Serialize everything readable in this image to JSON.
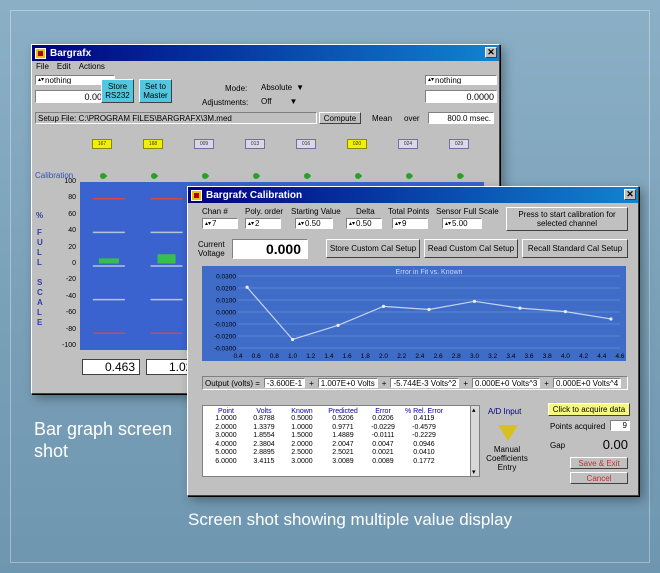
{
  "captions": {
    "bar_graph": "Bar graph screen shot",
    "multi_value": "Screen shot showing multiple value display"
  },
  "bargrafx": {
    "title": "Bargrafx",
    "menu": [
      "File",
      "Edit",
      "Actions"
    ],
    "left_select": "nothing",
    "left_value": "0.0000",
    "store_button": "Store RS232",
    "set_master_button": "Set to Master",
    "mode_label": "Mode:",
    "mode_value": "Absolute",
    "adjustments_label": "Adjustments:",
    "adjustments_value": "Off",
    "right_select": "nothing",
    "right_value": "0.0000",
    "setup_label": "Setup File:",
    "setup_path": "C:\\PROGRAM FILES\\BARGRAFX\\3M.med",
    "compute_label": "Compute",
    "mean_label": "Mean",
    "over_label": "over",
    "msec_value": "800.0 msec.",
    "channels": [
      "167",
      "168",
      "009",
      "013",
      "016",
      "020",
      "024",
      "029"
    ],
    "calibration_label": "Calibration",
    "y_ticks": [
      "100",
      "80",
      "60",
      "40",
      "20",
      "0",
      "-20",
      "-40",
      "-60",
      "-80",
      "-100"
    ],
    "side_letters_top": [
      "%"
    ],
    "side_letters": [
      "F",
      "U",
      "L",
      "L",
      "",
      "S",
      "C",
      "A",
      "L",
      "E"
    ],
    "readouts": [
      "0.463",
      "1.023"
    ],
    "colors": {
      "plot_bg": "#3a63d0",
      "bar": "#36c04a",
      "limit_line_red": "#d04848"
    }
  },
  "calibration": {
    "title": "Bargrafx Calibration",
    "chan_label": "Chan #",
    "chan_value": "7",
    "poly_label": "Poly. order",
    "poly_value": "2",
    "start_label": "Starting Value",
    "start_value": "0.50",
    "delta_label": "Delta",
    "delta_value": "0.50",
    "total_label": "Total Points",
    "total_value": "9",
    "fullscale_label": "Sensor Full Scale",
    "fullscale_value": "5.00",
    "start_cal_button": "Press to start calibration for selected channel",
    "current_voltage_label": "Current Voltage",
    "current_voltage_value": "0.000",
    "store_custom_button": "Store Custom Cal Setup",
    "read_custom_button": "Read Custom Cal Setup",
    "recall_standard_button": "Recall Standard Cal Setup",
    "output_label": "Output (volts) =",
    "coef0": "-3.600E-1",
    "coef1": "1.007E+0 Volts",
    "coef2": "-5.744E-3 Volts^2",
    "coef3": "0.000E+0 Volts^3",
    "coef4": "0.000E+0 Volts^4",
    "plus": "+",
    "table_headers": [
      "Point",
      "Volts",
      "Known",
      "Predicted",
      "Error",
      "% Rel. Error"
    ],
    "table_rows": [
      [
        "1.0000",
        "0.8788",
        "0.5000",
        "0.5206",
        "0.0206",
        "0.4119"
      ],
      [
        "2.0000",
        "1.3379",
        "1.0000",
        "0.9771",
        "-0.0229",
        "-0.4579"
      ],
      [
        "3.0000",
        "1.8554",
        "1.5000",
        "1.4889",
        "-0.0111",
        "-0.2229"
      ],
      [
        "4.0000",
        "2.3804",
        "2.0000",
        "2.0047",
        "0.0047",
        "0.0946"
      ],
      [
        "5.0000",
        "2.8895",
        "2.5000",
        "2.5021",
        "0.0021",
        "0.0410"
      ],
      [
        "6.0000",
        "3.4115",
        "3.0000",
        "3.0089",
        "0.0089",
        "0.1772"
      ]
    ],
    "ad_input_label": "A/D Input",
    "manual_entry_label": "Manual Coefficients Entry",
    "acquire_button": "Click to acquire data",
    "points_acquired_label": "Points acquired",
    "points_acquired_value": "9",
    "gap_label": "Gap",
    "gap_value": "0.00",
    "save_exit_button": "Save & Exit",
    "cancel_button": "Cancel"
  },
  "chart_data": {
    "type": "line",
    "title": "Error in Fit vs. Known",
    "x": [
      0.5,
      1.0,
      1.5,
      2.0,
      2.5,
      3.0,
      3.5,
      4.0,
      4.5
    ],
    "series": [
      {
        "values": [
          0.0206,
          -0.0229,
          -0.0111,
          0.0047,
          0.0021,
          0.0089,
          0.0032,
          0.0003,
          -0.0058
        ]
      }
    ],
    "x_ticks": [
      "0.4",
      "0.6",
      "0.8",
      "1.0",
      "1.2",
      "1.4",
      "1.6",
      "1.8",
      "2.0",
      "2.2",
      "2.4",
      "2.6",
      "2.8",
      "3.0",
      "3.2",
      "3.4",
      "3.6",
      "3.8",
      "4.0",
      "4.2",
      "4.4",
      "4.6"
    ],
    "y_ticks": [
      "0.0300",
      "0.0200",
      "0.0100",
      "0.0000",
      "-0.0100",
      "-0.0200",
      "-0.0300"
    ],
    "xlim": [
      0.4,
      4.6
    ],
    "ylim": [
      -0.03,
      0.03
    ],
    "grid": true,
    "colors": {
      "background": "#3f6cc7",
      "line": "#c8d4f0",
      "grid": "#7ea0e6"
    }
  }
}
